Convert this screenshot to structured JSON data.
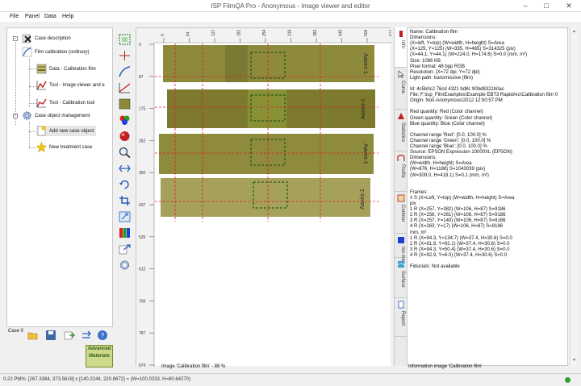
{
  "window": {
    "title": "ISP FilmQA Pro - Anonymous - Image viewer and editor",
    "minimize": "–",
    "maximize": "□",
    "close": "✕"
  },
  "menu": [
    "File",
    "Panel",
    "Data",
    "Help"
  ],
  "tree": {
    "case_description": "Case description",
    "film_calibration": "Film calibration (ordinary)",
    "data_calibration_film": "Data - Calibration film",
    "tool_image_viewer": "Tool - Image viewer and e",
    "tool_calibration": "Tool - Calibration tool",
    "case_management": "Case object management",
    "add_new_case": "Add new case object",
    "new_treatment": "New treatment case"
  },
  "case_label": "Case 0",
  "logo": {
    "line1": "Advanced",
    "line2": "Materials"
  },
  "viewer": {
    "status": "Image 'Calibration film' - 88 %",
    "top_ticks": [
      "0",
      "64",
      "127",
      "191",
      "254",
      "318",
      "382",
      "445",
      "509",
      "572"
    ],
    "left_ticks": [
      "0",
      "87",
      "175",
      "262",
      "350",
      "437",
      "525",
      "612",
      "700",
      "787",
      "874"
    ],
    "film_labels": [
      "Aavirs-1",
      "Aavirs-1",
      "Aavirs-1",
      "Aavirs-1"
    ]
  },
  "tabs": [
    "Info",
    "Curve",
    "Statistics",
    "Profile",
    "Contour",
    "Iso map",
    "Surface",
    "Report"
  ],
  "info": {
    "lines": [
      "Name: Calibration film",
      "Dimensions:",
      "(X=left, Y=top) (W=width, H=height) S=Area",
      "(X=125, Y=125) (W=335, H=485) S=314325 (pix)",
      "(X=44.1, Y=44.1) (W=224.0, H=174.6) S=0.0 (mm, m²)",
      "Size: 1086 KB",
      "Pixel format: 48 bpp RGB",
      "Resolution: (X=72 dpi, Y=72 dpi)",
      "Light path: transmissive (film)",
      "",
      "Id: 4c5b0c2 76cd 4321 bd8c 90bd8321b0ac",
      "File: F:\\isp_FilmExamples\\Example EBT3 RapidArc\\Calibration film 0",
      "Origin: Non-Anonymous\\2012 12:50:57 PM",
      "",
      "Red quantity: Red (Color channel)",
      "Green quantity: Green (Color channel)",
      "Blue quantity: Blue (Color channel)",
      "",
      "Channel range 'Red': [0.0, 100.0] %",
      "Channel range 'Green': [0.0, 100.0] %",
      "Channel range 'Blue': [0.0, 100.0] %",
      "Source: EPSON Expression 10000XL (EPSON)",
      "Dimensions:",
      "(W=width, H=height) S=Area",
      "(W=876, H=1188) S=1043039 (pix)",
      "(W=309.0, H=418.1) S=0.1 (mm, m²)",
      "",
      "",
      "Frames:",
      "# S (X=Left, Y=top) (W=width, H=height) S=Area",
      "pix",
      "1 R (X=257, Y=382) (W=106, H=87) S=9186",
      "2 R (X=256, Y=261) (W=106, H=87) S=9186",
      "3 R (X=257, Y=140) (W=106, H=87) S=9186",
      "4 R (X=263, Y=17) (W=106, H=87) S=9186",
      "mm, m²",
      "1 R (X=94.3, Y=134.7) (W=37.4, H=30.6) S=0.0",
      "2 R (X=91.9, Y=92.1) (W=37.4, H=30.6) S=0.0",
      "3 R (X=94.3, Y=50.4) (W=37.4, H=30.6) S=0.0",
      "4 R (X=92.9, Y=6.0) (W=37.4, H=30.6) S=0.0",
      "",
      "Fiducials: Not available"
    ],
    "footer": "Information image 'Calibration film'"
  },
  "status": {
    "text": "0.22 PM%: [267.3384, 373.5618] x [140.2244, 220.8672] = (W=100.0233, H=80.64270)"
  },
  "colors": {
    "film": "#8d8a3c",
    "film_dark": "#5f5c2a",
    "dash_red": "#e02020",
    "roi_green": "#1a6a1a",
    "accent": "#2a7ac0"
  }
}
